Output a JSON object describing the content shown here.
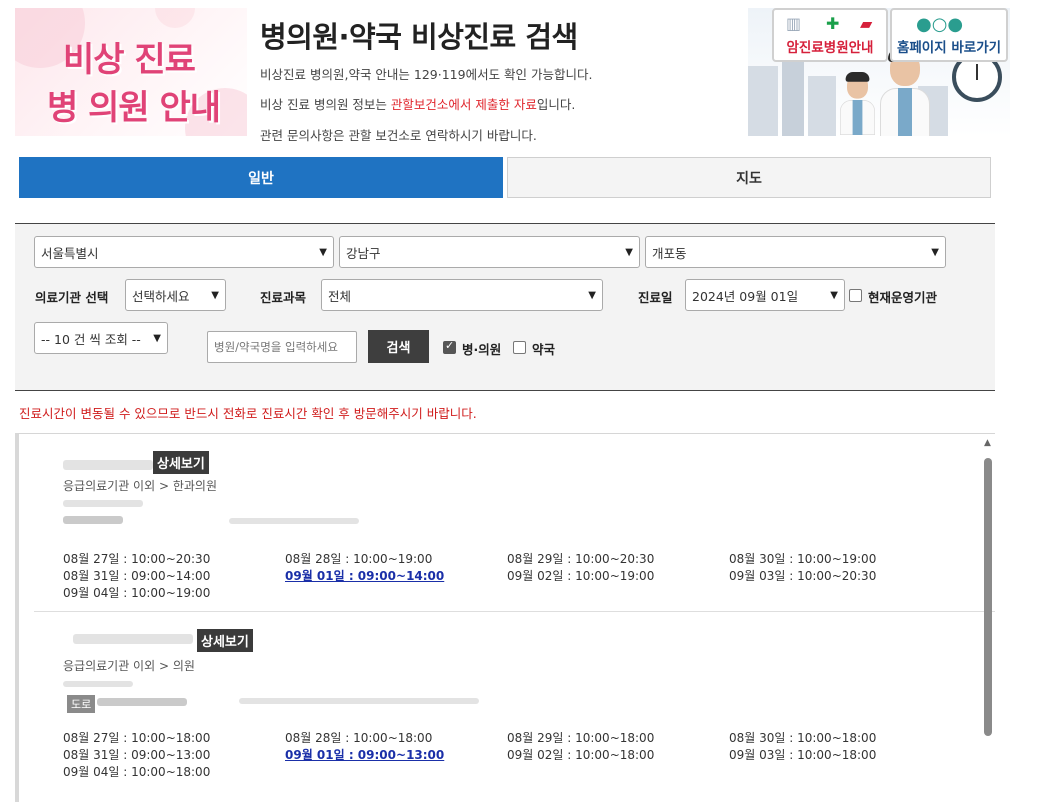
{
  "header": {
    "banner_left": {
      "line1": "비상 진료",
      "line2": "병 의원 안내"
    },
    "title": "병의원·약국 비상진료 검색",
    "info_line1": "비상진료 병의원,약국 안내는 129·119에서도 확인 가능합니다.",
    "info_line2_pre": "비상 진료 병의원 정보는 ",
    "info_line2_red": "관할보건소에서 제출한 자료",
    "info_line2_post": "입니다.",
    "info_line3": "관련 문의사항은 관할 보건소로 연락하시기 바랍니다.",
    "banner_right": {
      "button1": "암진료병원안내",
      "button2": "홈페이지 바로가기"
    }
  },
  "tabs": [
    {
      "label": "일반",
      "active": true
    },
    {
      "label": "지도",
      "active": false
    }
  ],
  "search": {
    "city": "서울특별시",
    "district": "강남구",
    "dong": "개포동",
    "institution_label": "의료기관 선택",
    "institution_value": "선택하세요",
    "department_label": "진료과목",
    "department_value": "전체",
    "date_label": "진료일",
    "date_value": "2024년 09월 01일",
    "open_now_label": "현재운영기관",
    "page_size": "-- 10 건 씩 조회 --",
    "name_placeholder": "병원/약국명을 입력하세요",
    "search_button": "검색",
    "hospital_label": "병·의원",
    "pharmacy_label": "약국"
  },
  "notice": "진료시간이 변동될 수 있으므로 반드시 전화로 진료시간 확인 후 방문해주시기 바랍니다.",
  "results": [
    {
      "detail_label": "상세보기",
      "category": "응급의료기관 이외 > 한과의원",
      "hours": [
        "08월 27일 : 10:00~20:30",
        "08월 28일 : 10:00~19:00",
        "08월 29일 : 10:00~20:30",
        "08월 30일 : 10:00~19:00",
        "08월 31일 : 09:00~14:00",
        "09월 01일 : 09:00~14:00",
        "09월 02일 : 10:00~19:00",
        "09월 03일 : 10:00~20:30",
        "09월 04일 : 10:00~19:00"
      ]
    },
    {
      "detail_label": "상세보기",
      "category": "응급의료기관 이외 > 의원",
      "road_tag": "도로",
      "hours": [
        "08월 27일 : 10:00~18:00",
        "08월 28일 : 10:00~18:00",
        "08월 29일 : 10:00~18:00",
        "08월 30일 : 10:00~18:00",
        "08월 31일 : 09:00~13:00",
        "09월 01일 : 09:00~13:00",
        "09월 02일 : 10:00~18:00",
        "09월 03일 : 10:00~18:00",
        "09월 04일 : 10:00~18:00"
      ]
    }
  ],
  "colors": {
    "tab_active": "#1f73c2",
    "notice_red": "#d01c1c",
    "today_link": "#1a2fa8",
    "banner_pink": "#e04377"
  }
}
